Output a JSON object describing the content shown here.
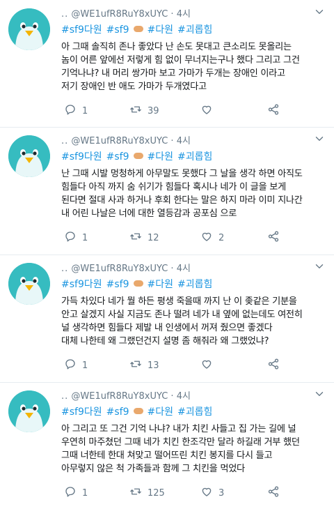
{
  "tweets": [
    {
      "author": "@WE1ufR8RuY8xUYC",
      "time": "4시",
      "hashtags": [
        "#sf9다원",
        "#sf9"
      ],
      "hashtags2": [
        "#다원",
        "#괴롭힘"
      ],
      "lines": [
        "아 그때 솔직히 존나 좋았다 난 손도 못대고 큰소리도 못올리는",
        "놈이 어른 앞에선 저렇게 힘 없이 무너지는구나 했다 그리고 그건",
        "기억나냐? 내 머리 쌍가마 보고 가마가 두개는 장애인 이라고",
        "저기 장애인 반 애도 가마가 두개였다고"
      ],
      "reply_count": "1",
      "retweet_count": "39",
      "like_count": ""
    },
    {
      "author": "@WE1ufR8RuY8xUYC",
      "time": "4시",
      "hashtags": [
        "#sf9다원",
        "#sf9"
      ],
      "hashtags2": [
        "#다원",
        "#괴롭힘"
      ],
      "lines": [
        "난 그때 시발 멍청하게 아무말도 못했다 그 날을 생각 하면 아직도",
        "힘들다 아직 까지 숨 쉬기가 힘들다 혹시나 네가 이 글을 보게",
        "된다면 절대 사과 하거나 후회 한다는 말은 하지 마라 이미 지나간",
        "내 어린 나날은 너에 대한 열등감과 공포심 으로"
      ],
      "reply_count": "1",
      "retweet_count": "12",
      "like_count": "2"
    },
    {
      "author": "@WE1ufR8RuY8xUYC",
      "time": "4시",
      "hashtags": [
        "#sf9다원",
        "#sf9"
      ],
      "hashtags2": [
        "#다원",
        "#괴롭힘"
      ],
      "lines": [
        "가득 차있다 네가 뭘 하든 평생 죽을때 까지 난 이 좆같은 기분을",
        "안고 살겠지 사실 지금도 존나 떨려 네가 내 옆에 없는데도 여전히",
        "널 생각하면 힘들다 제발 내 인생에서 꺼져 줬으면 좋겠다",
        "대체 나한테 왜 그랬던건지 설명 좀 해줘라 왜 그랬었냐?"
      ],
      "reply_count": "1",
      "retweet_count": "13",
      "like_count": ""
    },
    {
      "author": "@WE1ufR8RuY8xUYC",
      "time": "4시",
      "hashtags": [
        "#sf9다원",
        "#sf9"
      ],
      "hashtags2": [
        "#다원",
        "#괴롭힘"
      ],
      "lines": [
        "아 그리고 또 그건 기억 나냐? 내가 치킨 사들고 집 가는 길에 널",
        "우연히 마주쳤던 그때 네가 치킨 한조각만 달라 하길래 거부 했던",
        "그때 너한테 한대 쳐맞고 떨어뜨린 치킨 봉지를 다시 들고",
        "아무렇지 않은 척 가족들과 함께 그 치킨을 먹었다"
      ],
      "reply_count": "1",
      "retweet_count": "125",
      "like_count": "3"
    }
  ],
  "colors": {
    "hashtag": "#1b95e0",
    "meta": "#657786",
    "avatar_bg": "#36bcc0",
    "text": "#14171a"
  },
  "icons": {
    "reply": "reply-icon",
    "retweet": "retweet-icon",
    "like": "heart-icon",
    "share": "share-icon",
    "more": "chevron-down-icon"
  }
}
